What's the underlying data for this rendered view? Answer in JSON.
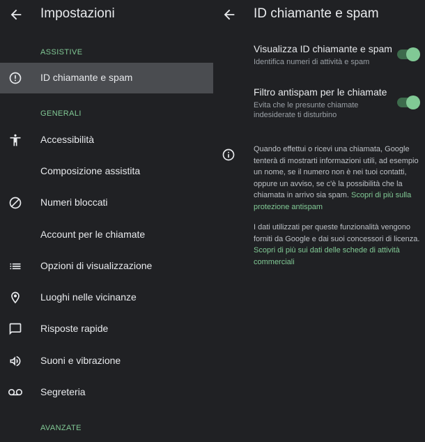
{
  "left": {
    "title": "Impostazioni",
    "sections": {
      "assistive": "ASSISTIVE",
      "generali": "GENERALI",
      "avanzate": "AVANZATE"
    },
    "items": [
      {
        "label": "ID chiamante e spam",
        "icon": "alert-circle-icon",
        "selected": true
      },
      {
        "label": "Accessibilità",
        "icon": "accessibility-icon"
      },
      {
        "label": "Composizione assistita",
        "icon": "none"
      },
      {
        "label": "Numeri bloccati",
        "icon": "block-icon"
      },
      {
        "label": "Account per le chiamate",
        "icon": "none"
      },
      {
        "label": "Opzioni di visualizzazione",
        "icon": "list-icon"
      },
      {
        "label": "Luoghi nelle vicinanze",
        "icon": "location-pin-icon"
      },
      {
        "label": "Risposte rapide",
        "icon": "message-icon"
      },
      {
        "label": "Suoni e vibrazione",
        "icon": "volume-icon"
      },
      {
        "label": "Segreteria",
        "icon": "voicemail-icon"
      }
    ]
  },
  "right": {
    "title": "ID chiamante e spam",
    "settings": [
      {
        "title": "Visualizza ID chiamante e spam",
        "summary": "Identifica numeri di attività e spam",
        "enabled": true
      },
      {
        "title": "Filtro antispam per le chiamate",
        "summary": "Evita che le presunte chiamate indesiderate ti disturbino",
        "enabled": true
      }
    ],
    "info": {
      "paragraph1": "Quando effettui o ricevi una chiamata, Google tenterà di mostrarti informazioni utili, ad esempio un nome, se il numero non è nei tuoi contatti, oppure un avviso, se c'è la possibilità che la chiamata in arrivo sia spam.",
      "link1": "Scopri di più sulla protezione antispam",
      "paragraph2": "I dati utilizzati per queste funzionalità vengono forniti da Google e dai suoi concessori di licenza.",
      "link2": "Scopri di più sui dati delle schede di attività commerciali"
    }
  },
  "colors": {
    "background": "#202124",
    "accent": "#81c995",
    "selected_row": "#4a4c50",
    "primary_text": "#e8eaed",
    "secondary_text": "#9aa0a6"
  }
}
